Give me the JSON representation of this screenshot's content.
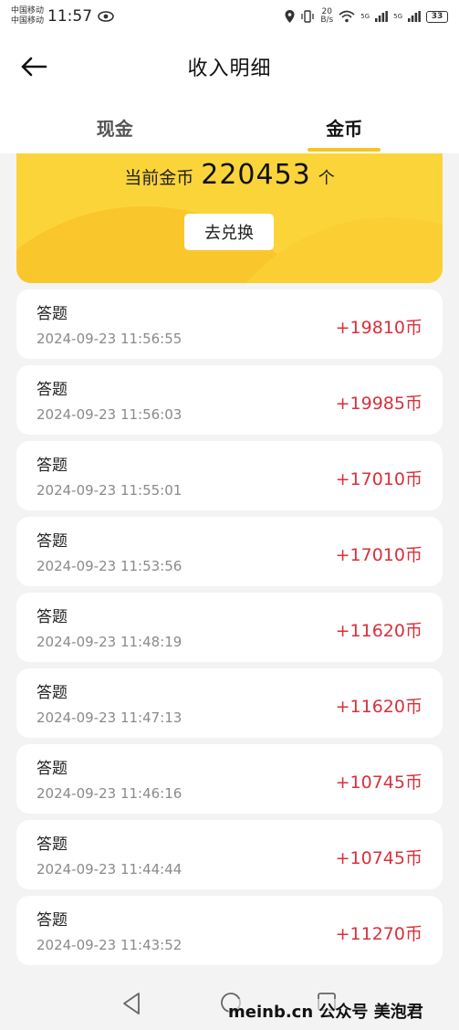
{
  "status_bar": {
    "carrier_1": "中国移动",
    "carrier_2": "中国移动",
    "time": "11:57",
    "net_speed_value": "20",
    "net_speed_unit": "B/s",
    "signal_1": "5G",
    "signal_2": "5G",
    "battery": "33"
  },
  "header": {
    "title": "收入明细"
  },
  "tabs": [
    {
      "label": "现金",
      "active": false
    },
    {
      "label": "金币",
      "active": true
    }
  ],
  "coin_card": {
    "label": "当前金币",
    "value": "220453",
    "unit": "个",
    "exchange_button": "去兑换"
  },
  "records": [
    {
      "title": "答题",
      "time": "2024-09-23 11:56:55",
      "amount": "+19810币"
    },
    {
      "title": "答题",
      "time": "2024-09-23 11:56:03",
      "amount": "+19985币"
    },
    {
      "title": "答题",
      "time": "2024-09-23 11:55:01",
      "amount": "+17010币"
    },
    {
      "title": "答题",
      "time": "2024-09-23 11:53:56",
      "amount": "+17010币"
    },
    {
      "title": "答题",
      "time": "2024-09-23 11:48:19",
      "amount": "+11620币"
    },
    {
      "title": "答题",
      "time": "2024-09-23 11:47:13",
      "amount": "+11620币"
    },
    {
      "title": "答题",
      "time": "2024-09-23 11:46:16",
      "amount": "+10745币"
    },
    {
      "title": "答题",
      "time": "2024-09-23 11:44:44",
      "amount": "+10745币"
    },
    {
      "title": "答题",
      "time": "2024-09-23 11:43:52",
      "amount": "+11270币"
    }
  ],
  "watermark": "meinb.cn 公众号 美泡君",
  "colors": {
    "accent_yellow": "#fbd43a",
    "amount_red": "#d9303c",
    "tab_indicator": "#f7c325"
  },
  "icons": {
    "back": "arrow-left-icon",
    "eye": "eye-icon",
    "location": "location-icon",
    "vibrate": "vibrate-icon",
    "wifi": "wifi-icon",
    "signal": "signal-icon",
    "battery": "battery-icon",
    "nav_back": "triangle-back-icon",
    "nav_home": "circle-home-icon",
    "nav_recent": "square-recent-icon"
  }
}
